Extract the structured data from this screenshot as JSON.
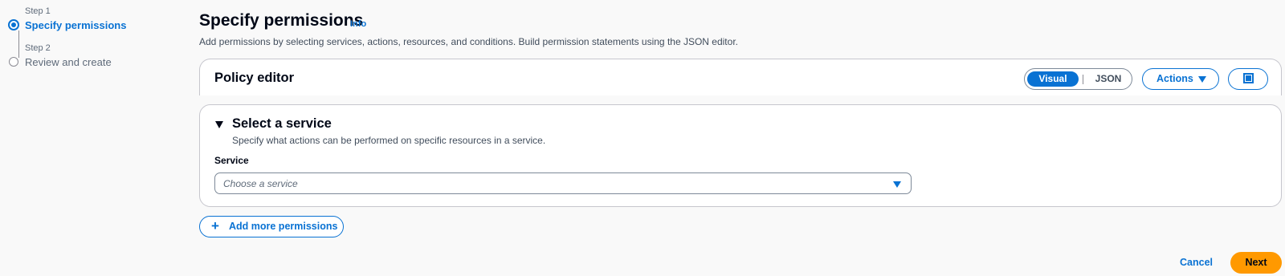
{
  "stepper": {
    "steps": [
      {
        "caption": "Step 1",
        "title": "Specify permissions",
        "state": "active"
      },
      {
        "caption": "Step 2",
        "title": "Review and create",
        "state": "inactive"
      }
    ]
  },
  "header": {
    "title": "Specify permissions",
    "info": "Info",
    "description": "Add permissions by selecting services, actions, resources, and conditions. Build permission statements using the JSON editor."
  },
  "policy_editor": {
    "title": "Policy editor",
    "mode_options": [
      "Visual",
      "JSON"
    ],
    "selected_mode": "Visual",
    "actions_label": "Actions"
  },
  "service_section": {
    "title": "Select a service",
    "description": "Specify what actions can be performed on specific resources in a service.",
    "field_label": "Service",
    "placeholder": "Choose a service"
  },
  "add_permissions_label": "Add more permissions",
  "footer": {
    "cancel_label": "Cancel",
    "next_label": "Next"
  },
  "colors": {
    "accent": "#0972d3",
    "primary_button": "#ff9900",
    "text": "#000716"
  }
}
